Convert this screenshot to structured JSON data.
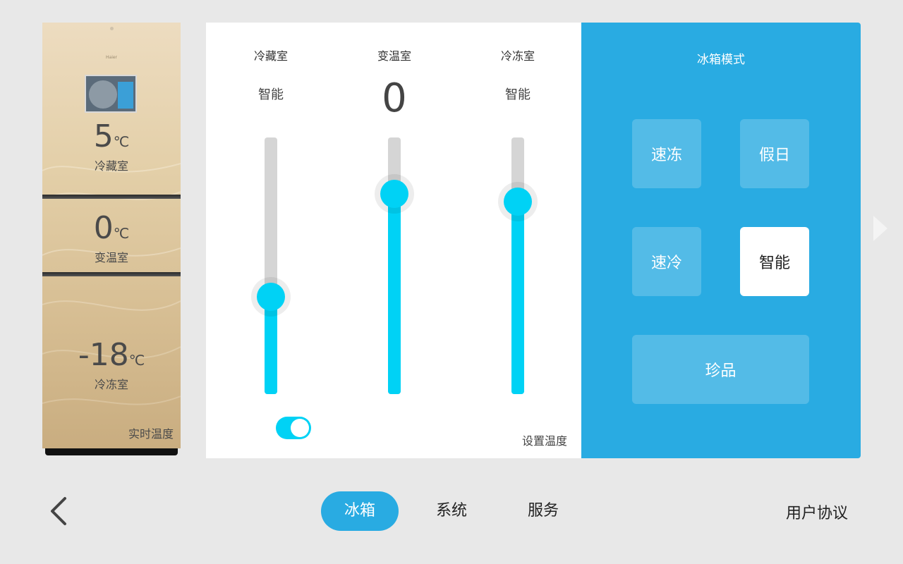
{
  "fridge": {
    "brand": "Haier",
    "refrigerator": {
      "value": "5",
      "unit": "℃",
      "label": "冷藏室"
    },
    "variable": {
      "value": "0",
      "unit": "℃",
      "label": "变温室"
    },
    "freezer": {
      "value": "-18",
      "unit": "℃",
      "label": "冷冻室"
    },
    "realtime_label": "实时温度"
  },
  "sliders": [
    {
      "title": "冷藏室",
      "setting": "智能",
      "level": 0.38
    },
    {
      "title": "变温室",
      "setting": "0",
      "level": 0.78
    },
    {
      "title": "冷冻室",
      "setting": "智能",
      "level": 0.75
    }
  ],
  "toggle": {
    "on": true
  },
  "set_temp_label": "设置温度",
  "mode_panel": {
    "title": "冰箱模式",
    "buttons": [
      {
        "label": "速冻",
        "active": false
      },
      {
        "label": "假日",
        "active": false
      },
      {
        "label": "速冷",
        "active": false
      },
      {
        "label": "智能",
        "active": true
      },
      {
        "label": "珍品",
        "active": false
      }
    ]
  },
  "nav": {
    "tabs": [
      "冰箱",
      "系统",
      "服务"
    ],
    "active_tab": "冰箱",
    "agreement": "用户协议"
  },
  "colors": {
    "accent": "#29abe2",
    "slider": "#00d2f5"
  }
}
